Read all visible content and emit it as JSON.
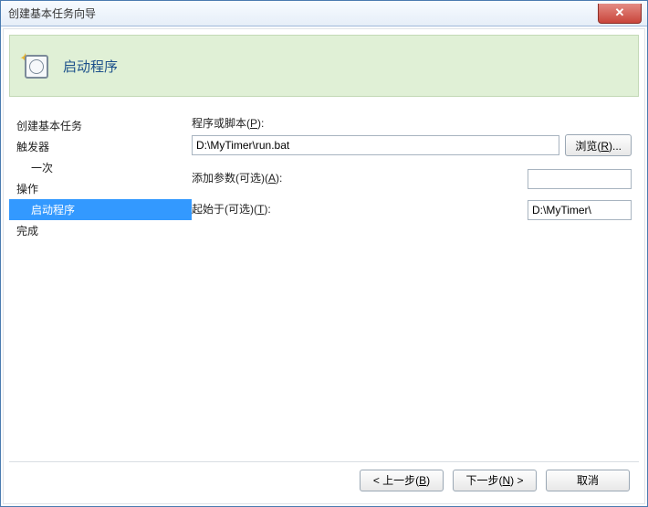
{
  "window": {
    "title": "创建基本任务向导"
  },
  "header": {
    "title": "启动程序"
  },
  "sidebar": {
    "items": [
      {
        "label": "创建基本任务",
        "level": 0,
        "selected": false
      },
      {
        "label": "触发器",
        "level": 0,
        "selected": false
      },
      {
        "label": "一次",
        "level": 1,
        "selected": false
      },
      {
        "label": "操作",
        "level": 0,
        "selected": false
      },
      {
        "label": "启动程序",
        "level": 1,
        "selected": true
      },
      {
        "label": "完成",
        "level": 0,
        "selected": false
      }
    ]
  },
  "form": {
    "script_label_pre": "程序或脚本(",
    "script_label_key": "P",
    "script_label_post": "):",
    "script_value": "D:\\MyTimer\\run.bat",
    "browse_pre": "浏览(",
    "browse_key": "R",
    "browse_post": ")...",
    "args_label_pre": "添加参数(可选)(",
    "args_label_key": "A",
    "args_label_post": "):",
    "args_value": "",
    "startin_label_pre": "起始于(可选)(",
    "startin_label_key": "T",
    "startin_label_post": "):",
    "startin_value": "D:\\MyTimer\\"
  },
  "footer": {
    "back_pre": "< 上一步(",
    "back_key": "B",
    "back_post": ")",
    "next_pre": "下一步(",
    "next_key": "N",
    "next_post": ") >",
    "cancel": "取消"
  }
}
